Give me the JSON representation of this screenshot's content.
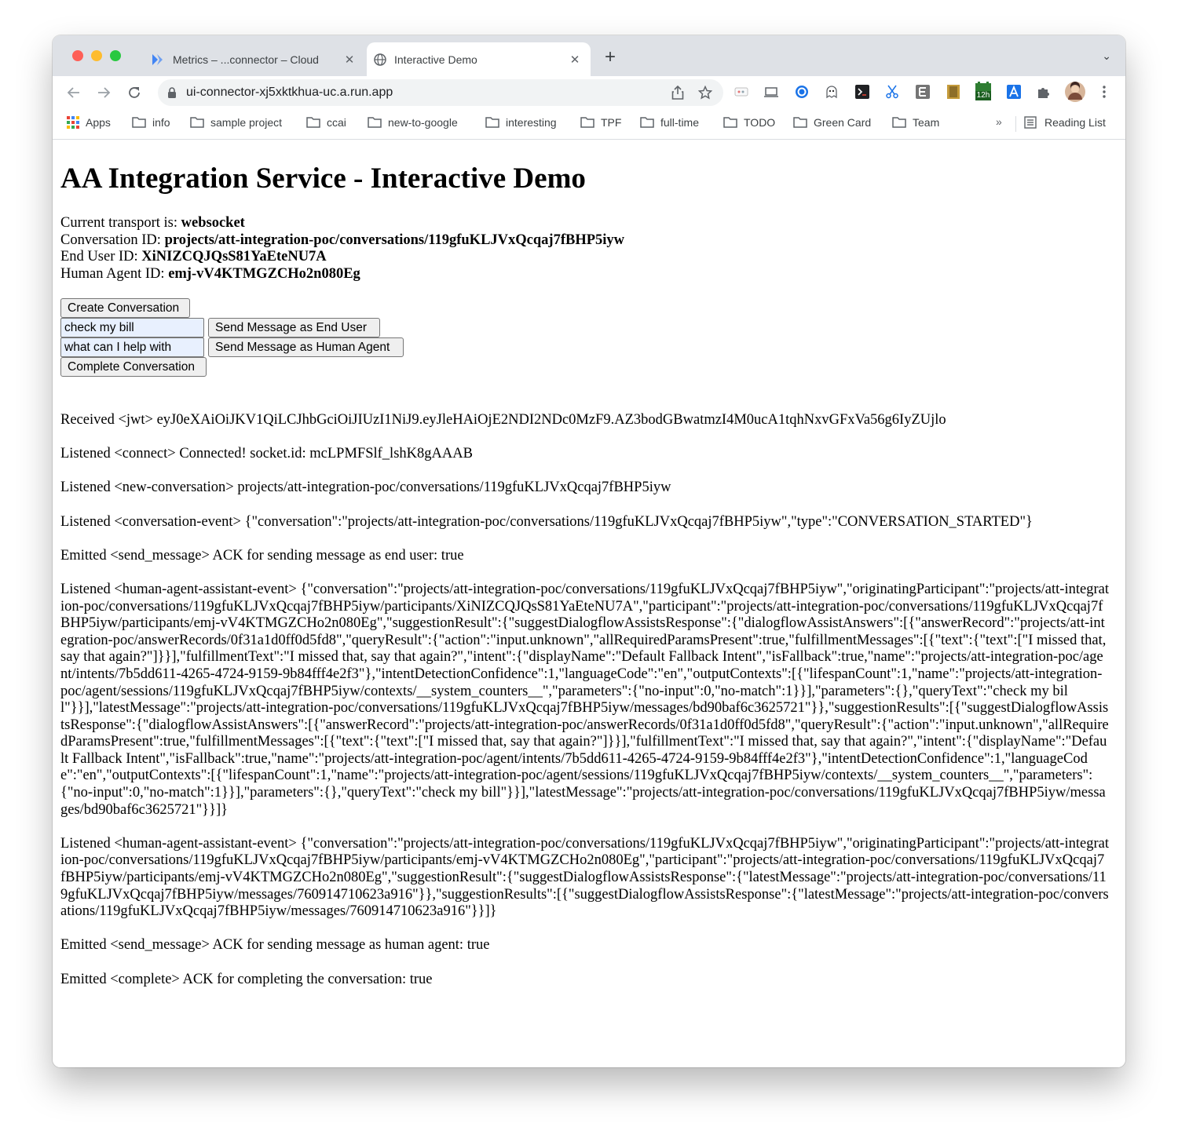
{
  "browser": {
    "tabs": [
      {
        "title": "Metrics – ...connector – Cloud",
        "active": false,
        "close": "✕"
      },
      {
        "title": "Interactive Demo",
        "active": true,
        "close": "✕"
      }
    ],
    "new_tab": "+",
    "tab_menu": "⌄",
    "url": "ui-connector-xj5xktkhua-uc.a.run.app",
    "bookmarks": [
      "Apps",
      "info",
      "sample project",
      "ccai",
      "new-to-google",
      "interesting",
      "TPF",
      "full-time",
      "TODO",
      "Green Card",
      "Team"
    ],
    "bookmarks_more": "»",
    "reading_list": "Reading List",
    "extension_badge": "12h"
  },
  "page": {
    "title": "AA Integration Service - Interactive Demo",
    "info": [
      {
        "label": "Current transport is: ",
        "value": "websocket"
      },
      {
        "label": "Conversation ID: ",
        "value": "projects/att-integration-poc/conversations/119gfuKLJVxQcqaj7fBHP5iyw"
      },
      {
        "label": "End User ID: ",
        "value": "XiNIZCQJQsS81YaEteNU7A"
      },
      {
        "label": "Human Agent ID: ",
        "value": "emj-vV4KTMGZCHo2n080Eg"
      }
    ],
    "buttons": {
      "create": "Create Conversation",
      "send_end_user": "Send Message as End User",
      "send_human_agent": "Send Message as Human Agent",
      "complete": "Complete Conversation"
    },
    "inputs": {
      "end_user_message": "check my bill",
      "human_agent_message": "what can I help with"
    },
    "log": [
      "Received <jwt> eyJ0eXAiOiJKV1QiLCJhbGciOiJIUzI1NiJ9.eyJleHAiOjE2NDI2NDc0MzF9.AZ3bodGBwatmzI4M0ucA1tqhNxvGFxVa56g6IyZUjlo",
      "Listened <connect> Connected! socket.id: mcLPMFSlf_lshK8gAAAB",
      "Listened <new-conversation> projects/att-integration-poc/conversations/119gfuKLJVxQcqaj7fBHP5iyw",
      "Listened <conversation-event> {\"conversation\":\"projects/att-integration-poc/conversations/119gfuKLJVxQcqaj7fBHP5iyw\",\"type\":\"CONVERSATION_STARTED\"}",
      "Emitted <send_message> ACK for sending message as end user: true",
      "Listened <human-agent-assistant-event> {\"conversation\":\"projects/att-integration-poc/conversations/119gfuKLJVxQcqaj7fBHP5iyw\",\"originatingParticipant\":\"projects/att-integration-poc/conversations/119gfuKLJVxQcqaj7fBHP5iyw/participants/XiNIZCQJQsS81YaEteNU7A\",\"participant\":\"projects/att-integration-poc/conversations/119gfuKLJVxQcqaj7fBHP5iyw/participants/emj-vV4KTMGZCHo2n080Eg\",\"suggestionResult\":{\"suggestDialogflowAssistsResponse\":{\"dialogflowAssistAnswers\":[{\"answerRecord\":\"projects/att-integration-poc/answerRecords/0f31a1d0ff0d5fd8\",\"queryResult\":{\"action\":\"input.unknown\",\"allRequiredParamsPresent\":true,\"fulfillmentMessages\":[{\"text\":{\"text\":[\"I missed that, say that again?\"]}}],\"fulfillmentText\":\"I missed that, say that again?\",\"intent\":{\"displayName\":\"Default Fallback Intent\",\"isFallback\":true,\"name\":\"projects/att-integration-poc/agent/intents/7b5dd611-4265-4724-9159-9b84fff4e2f3\"},\"intentDetectionConfidence\":1,\"languageCode\":\"en\",\"outputContexts\":[{\"lifespanCount\":1,\"name\":\"projects/att-integration-poc/agent/sessions/119gfuKLJVxQcqaj7fBHP5iyw/contexts/__system_counters__\",\"parameters\":{\"no-input\":0,\"no-match\":1}}],\"parameters\":{},\"queryText\":\"check my bill\"}}],\"latestMessage\":\"projects/att-integration-poc/conversations/119gfuKLJVxQcqaj7fBHP5iyw/messages/bd90baf6c3625721\"}},\"suggestionResults\":[{\"suggestDialogflowAssistsResponse\":{\"dialogflowAssistAnswers\":[{\"answerRecord\":\"projects/att-integration-poc/answerRecords/0f31a1d0ff0d5fd8\",\"queryResult\":{\"action\":\"input.unknown\",\"allRequiredParamsPresent\":true,\"fulfillmentMessages\":[{\"text\":{\"text\":[\"I missed that, say that again?\"]}}],\"fulfillmentText\":\"I missed that, say that again?\",\"intent\":{\"displayName\":\"Default Fallback Intent\",\"isFallback\":true,\"name\":\"projects/att-integration-poc/agent/intents/7b5dd611-4265-4724-9159-9b84fff4e2f3\"},\"intentDetectionConfidence\":1,\"languageCode\":\"en\",\"outputContexts\":[{\"lifespanCount\":1,\"name\":\"projects/att-integration-poc/agent/sessions/119gfuKLJVxQcqaj7fBHP5iyw/contexts/__system_counters__\",\"parameters\":{\"no-input\":0,\"no-match\":1}}],\"parameters\":{},\"queryText\":\"check my bill\"}}],\"latestMessage\":\"projects/att-integration-poc/conversations/119gfuKLJVxQcqaj7fBHP5iyw/messages/bd90baf6c3625721\"}}]}",
      "Listened <human-agent-assistant-event> {\"conversation\":\"projects/att-integration-poc/conversations/119gfuKLJVxQcqaj7fBHP5iyw\",\"originatingParticipant\":\"projects/att-integration-poc/conversations/119gfuKLJVxQcqaj7fBHP5iyw/participants/emj-vV4KTMGZCHo2n080Eg\",\"participant\":\"projects/att-integration-poc/conversations/119gfuKLJVxQcqaj7fBHP5iyw/participants/emj-vV4KTMGZCHo2n080Eg\",\"suggestionResult\":{\"suggestDialogflowAssistsResponse\":{\"latestMessage\":\"projects/att-integration-poc/conversations/119gfuKLJVxQcqaj7fBHP5iyw/messages/760914710623a916\"}},\"suggestionResults\":[{\"suggestDialogflowAssistsResponse\":{\"latestMessage\":\"projects/att-integration-poc/conversations/119gfuKLJVxQcqaj7fBHP5iyw/messages/760914710623a916\"}}]}",
      "Emitted <send_message> ACK for sending message as human agent: true",
      "Emitted <complete> ACK for completing the conversation: true"
    ]
  },
  "colors": {
    "tabstrip": "#dee1e6",
    "omnibox": "#f1f3f4",
    "autofill_input": "#e8f0fe",
    "button_bg": "#efefef"
  }
}
